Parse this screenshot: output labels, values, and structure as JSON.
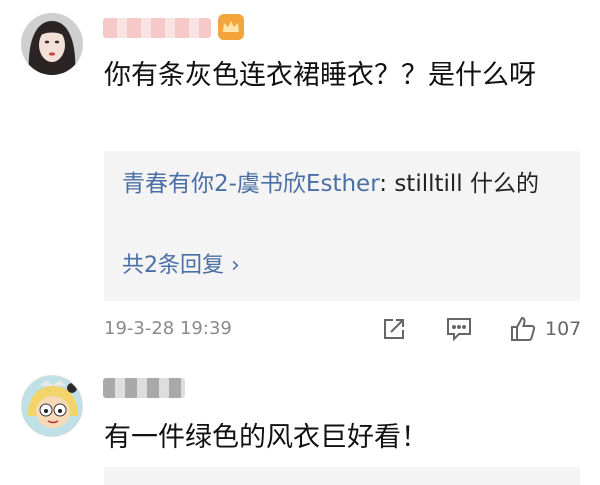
{
  "comments": [
    {
      "text": "你有条灰色连衣裙睡衣？？是什么呀",
      "reply_preview": {
        "author": "青春有你2-虞书欣Esther",
        "separator": ": ",
        "text": "stilltill 什么的"
      },
      "more_replies_label": "共2条回复 ›",
      "timestamp": "19-3-28 19:39",
      "like_count": "107",
      "icons": [
        "share-icon",
        "comment-icon",
        "like-icon"
      ]
    },
    {
      "text": "有一件绿色的风衣巨好看！"
    }
  ],
  "colors": {
    "link": "#4a6fa5",
    "reply_bg": "#f4f4f4",
    "meta": "#8a8a8a"
  }
}
